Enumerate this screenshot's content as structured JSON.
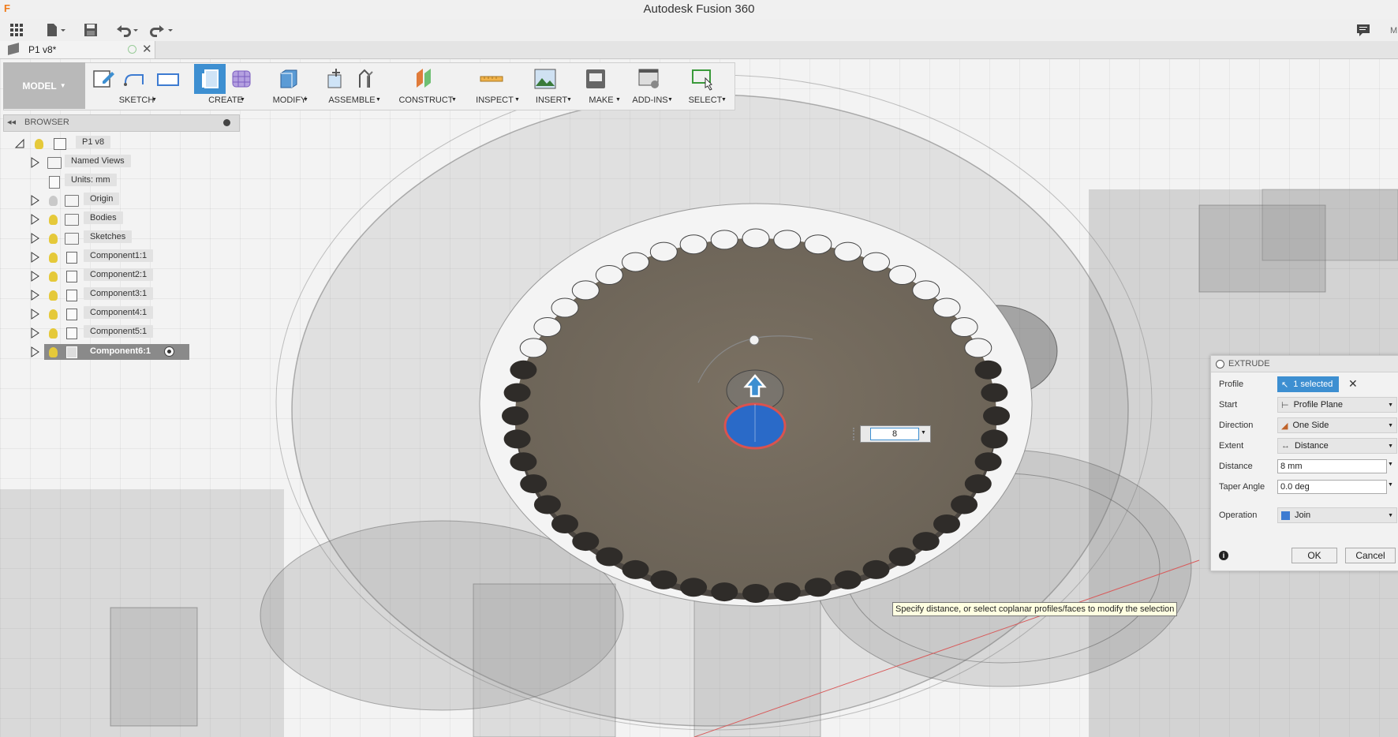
{
  "app": {
    "title": "Autodesk Fusion 360"
  },
  "document_tab": {
    "name": "P1 v8*"
  },
  "workspace": {
    "label": "MODEL"
  },
  "ribbon": {
    "groups": [
      {
        "label": "SKETCH",
        "icon": "sketch-icon"
      },
      {
        "label": "CREATE",
        "icon": "extrude-icon"
      },
      {
        "label": "MODIFY",
        "icon": "modify-icon"
      },
      {
        "label": "ASSEMBLE",
        "icon": "assemble-icon"
      },
      {
        "label": "CONSTRUCT",
        "icon": "construct-plane-icon"
      },
      {
        "label": "INSPECT",
        "icon": "measure-icon"
      },
      {
        "label": "INSERT",
        "icon": "insert-image-icon"
      },
      {
        "label": "MAKE",
        "icon": "print-icon"
      },
      {
        "label": "ADD-INS",
        "icon": "scripts-icon"
      },
      {
        "label": "SELECT",
        "icon": "select-cursor-icon"
      }
    ]
  },
  "browser": {
    "title": "BROWSER",
    "root": "P1 v8",
    "items": [
      {
        "label": "Named Views"
      },
      {
        "label": "Units: mm"
      },
      {
        "label": "Origin"
      },
      {
        "label": "Bodies"
      },
      {
        "label": "Sketches"
      },
      {
        "label": "Component1:1"
      },
      {
        "label": "Component2:1"
      },
      {
        "label": "Component3:1"
      },
      {
        "label": "Component4:1"
      },
      {
        "label": "Component5:1"
      },
      {
        "label": "Component6:1"
      }
    ]
  },
  "extrude": {
    "title": "EXTRUDE",
    "profile_label": "Profile",
    "profile_value": "1 selected",
    "start_label": "Start",
    "start_value": "Profile Plane",
    "direction_label": "Direction",
    "direction_value": "One Side",
    "extent_label": "Extent",
    "extent_value": "Distance",
    "distance_label": "Distance",
    "distance_value": "8 mm",
    "taper_label": "Taper Angle",
    "taper_value": "0.0 deg",
    "operation_label": "Operation",
    "operation_value": "Join",
    "ok": "OK",
    "cancel": "Cancel"
  },
  "inline_distance": {
    "value": "8"
  },
  "tooltip": {
    "text": "Specify distance, or select coplanar profiles/faces to modify the selection"
  },
  "colors": {
    "accent_blue": "#3d8fd1",
    "gear_face": "#736a5e",
    "selected_profile": "#2a6ac8"
  }
}
